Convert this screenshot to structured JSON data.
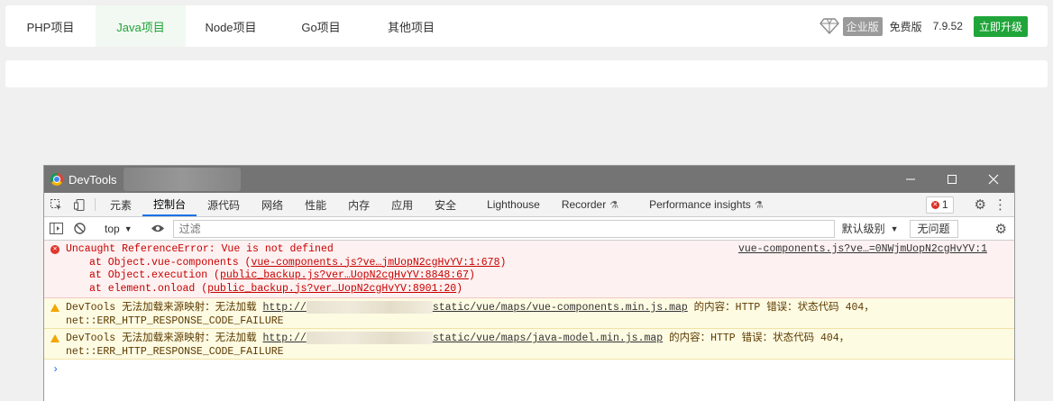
{
  "top": {
    "tabs": [
      {
        "label": "PHP项目",
        "active": false
      },
      {
        "label": "Java项目",
        "active": true
      },
      {
        "label": "Node项目",
        "active": false
      },
      {
        "label": "Go项目",
        "active": false
      },
      {
        "label": "其他项目",
        "active": false
      }
    ],
    "enterprise_label": "企业版",
    "free_label": "免费版",
    "version": "7.9.52",
    "upgrade_label": "立即升级"
  },
  "devtools": {
    "title": "DevTools",
    "tabs": [
      {
        "label": "元素"
      },
      {
        "label": "控制台"
      },
      {
        "label": "源代码"
      },
      {
        "label": "网络"
      },
      {
        "label": "性能"
      },
      {
        "label": "内存"
      },
      {
        "label": "应用"
      },
      {
        "label": "安全"
      },
      {
        "label": "Lighthouse"
      },
      {
        "label": "Recorder"
      },
      {
        "label": "Performance insights"
      }
    ],
    "error_count": "1",
    "console": {
      "context": "top",
      "filter_placeholder": "过滤",
      "level": "默认级别",
      "issues": "无问题"
    },
    "messages": {
      "error": {
        "text": "Uncaught ReferenceError: Vue is not defined",
        "source": "vue-components.js?ve…=0NWjmUopN2cgHvYV:1",
        "stack": [
          {
            "prefix": "at Object.vue-components (",
            "link": "vue-components.js?ve…jmUopN2cgHvYV:1:678",
            "suffix": ")"
          },
          {
            "prefix": "at Object.execution (",
            "link": "public_backup.js?ver…UopN2cgHvYV:8848:67",
            "suffix": ")"
          },
          {
            "prefix": "at element.onload (",
            "link": "public_backup.js?ver…UopN2cgHvYV:8901:20",
            "suffix": ")"
          }
        ]
      },
      "warn1": {
        "prefix": "DevTools 无法加载来源映射：无法加载 ",
        "link_start": "http://",
        "link_end": "static/vue/maps/vue-components.min.js.map",
        "suffix": " 的内容：HTTP 错误：状态代码 404，",
        "line2": "net::ERR_HTTP_RESPONSE_CODE_FAILURE"
      },
      "warn2": {
        "prefix": "DevTools 无法加载来源映射：无法加载 ",
        "link_start": "http://",
        "link_end": "static/vue/maps/java-model.min.js.map",
        "suffix": " 的内容：HTTP 错误：状态代码 404，",
        "line2": "net::ERR_HTTP_RESPONSE_CODE_FAILURE"
      }
    }
  }
}
